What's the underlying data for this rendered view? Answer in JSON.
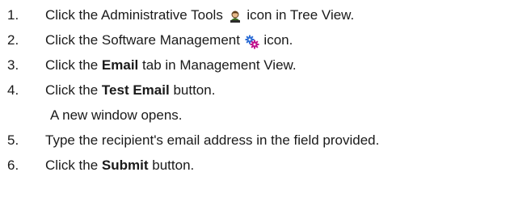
{
  "steps": [
    {
      "number": "1.",
      "before": "Click the Administrative Tools",
      "icon": "admin-user-icon",
      "after": "icon in Tree View."
    },
    {
      "number": "2.",
      "before": "Click the Software Management",
      "icon": "software-management-gears-icon",
      "after": "icon."
    },
    {
      "number": "3.",
      "before": "Click the",
      "bold": "Email",
      "after": "tab in Management View."
    },
    {
      "number": "4.",
      "before": "Click the",
      "bold": "Test Email",
      "after": "button."
    },
    {
      "note": "A new window opens."
    },
    {
      "number": "5.",
      "text": "Type the recipient's email address in the field provided."
    },
    {
      "number": "6.",
      "before": "Click the",
      "bold": "Submit",
      "after": "button."
    }
  ],
  "colors": {
    "text": "#1a1a1a",
    "admin_icon_shirt": "#3a6b1f",
    "admin_icon_skin": "#e7b98a",
    "gear_blue": "#2f6fd6",
    "gear_magenta": "#c0148c"
  }
}
